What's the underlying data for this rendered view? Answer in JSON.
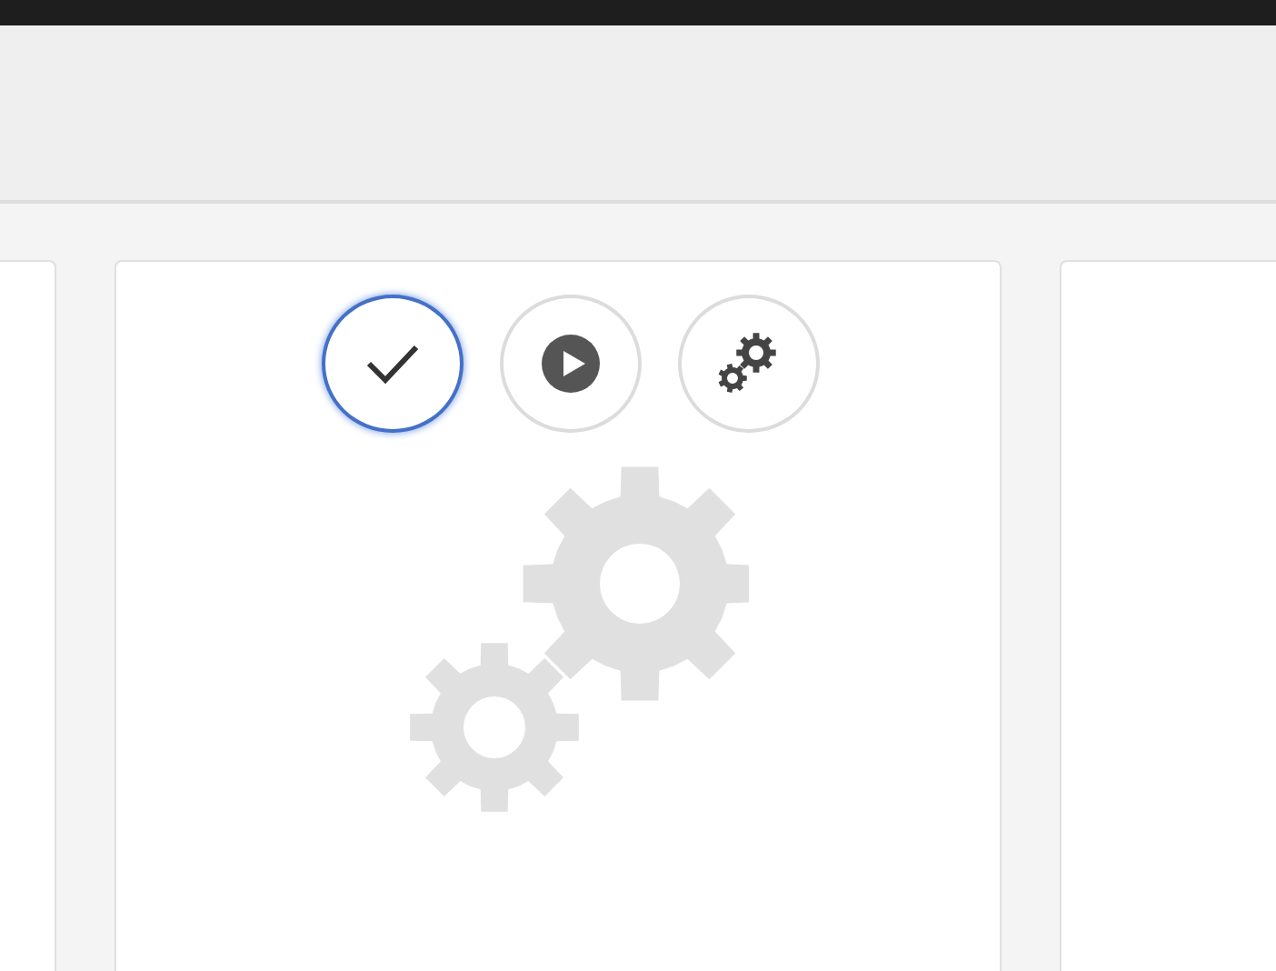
{
  "action_buttons": [
    {
      "kind": "check",
      "selected": true
    },
    {
      "kind": "play",
      "selected": false
    },
    {
      "kind": "gears",
      "selected": false
    }
  ]
}
